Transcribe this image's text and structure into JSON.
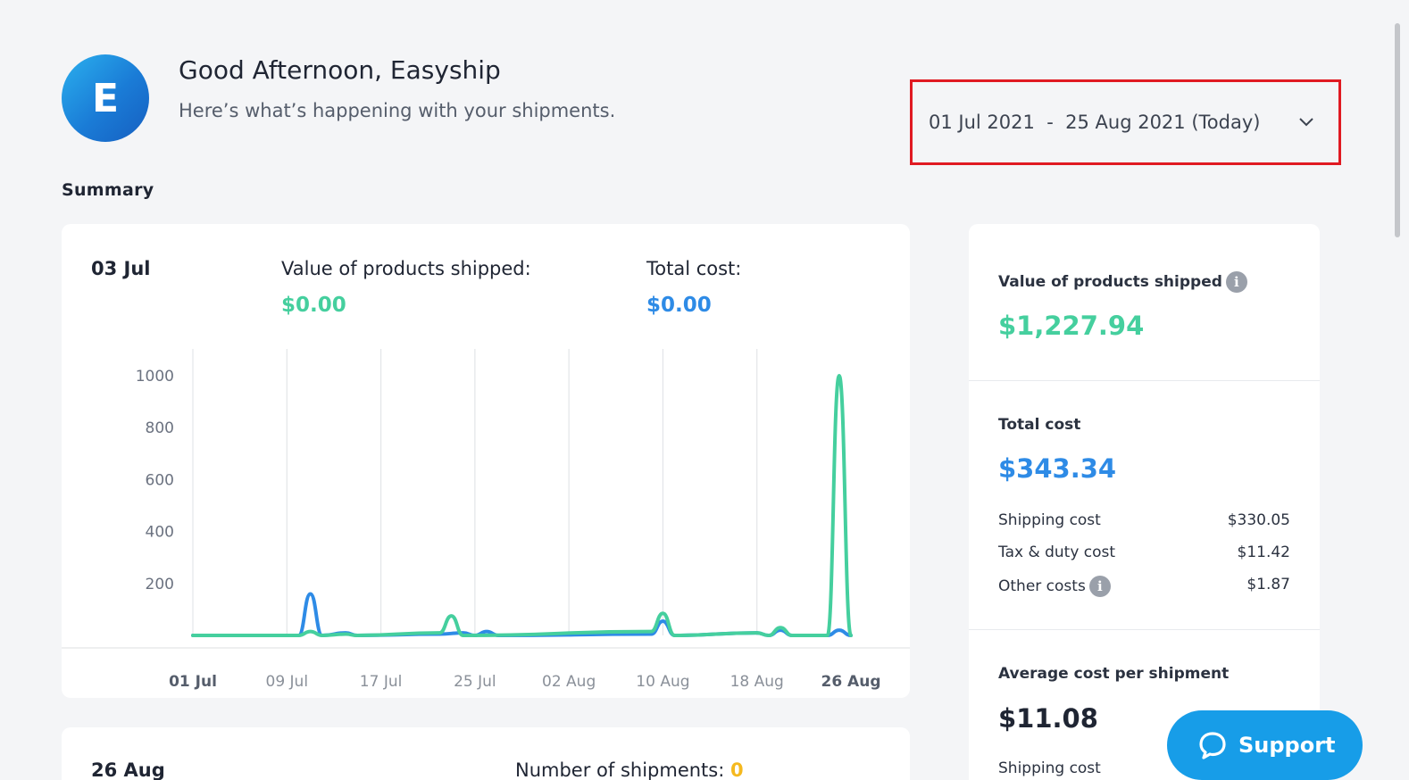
{
  "header": {
    "avatar_letter": "E",
    "greeting": "Good Afternoon, Easyship",
    "subtitle": "Here’s what’s happening with your shipments."
  },
  "date_range": {
    "label": "01 Jul 2021  -  25 Aug 2021 (Today)",
    "icon": "chevron-down-icon"
  },
  "summary_title": "Summary",
  "chart_card": {
    "date": "03 Jul",
    "value_label": "Value of products shipped:",
    "value": "$0.00",
    "cost_label": "Total cost:",
    "cost": "$0.00"
  },
  "second_card": {
    "date": "26 Aug",
    "shipments_label": "Number of shipments:",
    "shipments_value": "0"
  },
  "side": {
    "value_label": "Value of products shipped",
    "value": "$1,227.94",
    "total_cost_label": "Total cost",
    "total_cost": "$343.34",
    "rows": [
      {
        "label": "Shipping cost",
        "value": "$330.05"
      },
      {
        "label": "Tax & duty cost",
        "value": "$11.42"
      },
      {
        "label": "Other costs",
        "value": "$1.87"
      }
    ],
    "avg_label": "Average cost per shipment",
    "avg_value": "$11.08",
    "avg_sub_label": "Shipping cost"
  },
  "support": {
    "label": "Support"
  },
  "colors": {
    "value_green": "#45cf9e",
    "cost_blue": "#2e8be6",
    "highlight_red": "#e01a22",
    "support_blue": "#179de8"
  },
  "chart_data": {
    "type": "line",
    "y_ticks": [
      "1000",
      "800",
      "600",
      "400",
      "200"
    ],
    "x_ticks": [
      "01 Jul",
      "09 Jul",
      "17 Jul",
      "25 Jul",
      "02 Aug",
      "10 Aug",
      "18 Aug",
      "26 Aug"
    ],
    "ylim": [
      0,
      1000
    ],
    "x_start": "2021-07-01",
    "x_end": "2021-08-26",
    "series": [
      {
        "color": "#2e8be6",
        "points": [
          [
            "2021-07-01",
            0
          ],
          [
            "2021-07-10",
            0
          ],
          [
            "2021-07-11",
            160
          ],
          [
            "2021-07-12",
            0
          ],
          [
            "2021-07-14",
            10
          ],
          [
            "2021-07-15",
            0
          ],
          [
            "2021-07-22",
            5
          ],
          [
            "2021-07-24",
            10
          ],
          [
            "2021-07-25",
            0
          ],
          [
            "2021-07-26",
            15
          ],
          [
            "2021-07-27",
            0
          ],
          [
            "2021-08-09",
            5
          ],
          [
            "2021-08-10",
            55
          ],
          [
            "2021-08-11",
            0
          ],
          [
            "2021-08-18",
            10
          ],
          [
            "2021-08-19",
            0
          ],
          [
            "2021-08-20",
            20
          ],
          [
            "2021-08-21",
            0
          ],
          [
            "2021-08-24",
            0
          ],
          [
            "2021-08-25",
            20
          ],
          [
            "2021-08-26",
            0
          ]
        ]
      },
      {
        "color": "#45cf9e",
        "points": [
          [
            "2021-07-01",
            0
          ],
          [
            "2021-07-10",
            0
          ],
          [
            "2021-07-11",
            15
          ],
          [
            "2021-07-12",
            0
          ],
          [
            "2021-07-14",
            5
          ],
          [
            "2021-07-15",
            0
          ],
          [
            "2021-07-22",
            10
          ],
          [
            "2021-07-23",
            75
          ],
          [
            "2021-07-24",
            0
          ],
          [
            "2021-08-09",
            15
          ],
          [
            "2021-08-10",
            85
          ],
          [
            "2021-08-11",
            0
          ],
          [
            "2021-08-18",
            10
          ],
          [
            "2021-08-19",
            0
          ],
          [
            "2021-08-20",
            30
          ],
          [
            "2021-08-21",
            0
          ],
          [
            "2021-08-24",
            0
          ],
          [
            "2021-08-25",
            1000
          ],
          [
            "2021-08-26",
            0
          ]
        ]
      }
    ]
  }
}
